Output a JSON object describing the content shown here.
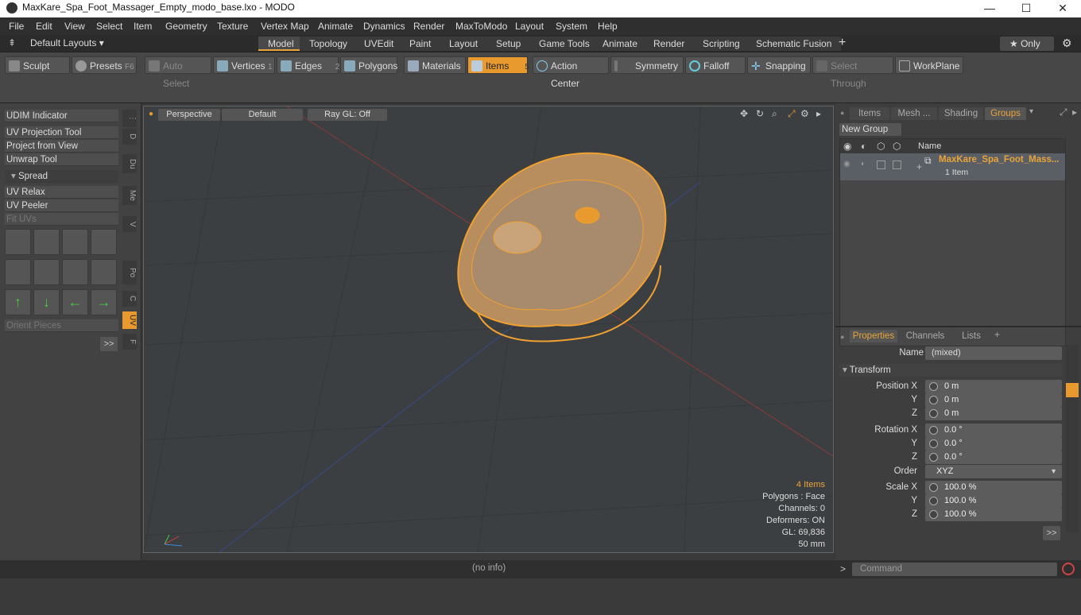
{
  "window": {
    "title": "MaxKare_Spa_Foot_Massager_Empty_modo_base.lxo - MODO",
    "min": "—",
    "max": "☐",
    "close": "✕"
  },
  "menu": [
    "File",
    "Edit",
    "View",
    "Select",
    "Item",
    "Geometry",
    "Texture",
    "Vertex Map",
    "Animate",
    "Dynamics",
    "Render",
    "MaxToModo",
    "Layout",
    "System",
    "Help"
  ],
  "layouts": {
    "default": "Default Layouts ▾",
    "tabs": [
      "Model",
      "Topology",
      "UVEdit",
      "Paint",
      "Layout",
      "Setup",
      "Game Tools",
      "Animate",
      "Render",
      "Scripting",
      "Schematic Fusion"
    ],
    "plus": "+",
    "only": "★  Only",
    "gear": "⚙"
  },
  "toolbar": {
    "sculpt": "Sculpt",
    "presets": "Presets",
    "presets_key": "F6",
    "auto_select": "Auto Select",
    "vertices": "Vertices",
    "vertices_n": "1",
    "edges": "Edges",
    "edges_n": "2",
    "polygons": "Polygons",
    "materials": "Materials",
    "items": "Items",
    "items_n": "5",
    "action_center": "Action Center",
    "symmetry": "Symmetry",
    "falloff": "Falloff",
    "snapping": "Snapping",
    "select_through": "Select Through",
    "workplane": "WorkPlane"
  },
  "left": {
    "buttons": [
      "UDIM Indicator",
      "UV Projection Tool",
      "Project from View",
      "Unwrap Tool"
    ],
    "spread": "Spread",
    "buttons2": [
      "UV Relax",
      "UV Peeler"
    ],
    "fit": "Fit UVs",
    "orient": "Orient Pieces",
    "more": ">>",
    "vtabs": [
      "D",
      "Du",
      "Me",
      "V",
      "Po",
      "C",
      "UV",
      "F"
    ]
  },
  "viewport": {
    "perspective": "Perspective",
    "default": "Default",
    "raygl": "Ray GL: Off",
    "items": "4 Items",
    "polygons": "Polygons : Face",
    "channels": "Channels: 0",
    "deformers": "Deformers: ON",
    "gl": "GL: 69,836",
    "mm": "50 mm"
  },
  "groups": {
    "tabs": [
      "Items",
      "Mesh ...",
      "Shading",
      "Groups"
    ],
    "new_group": "New Group",
    "name_col": "Name",
    "row_name": "MaxKare_Spa_Foot_Mass...",
    "row_sub": "1 Item"
  },
  "properties": {
    "tabs": [
      "Properties",
      "Channels",
      "Lists"
    ],
    "plus": "+",
    "name_label": "Name",
    "name_value": "(mixed)",
    "transform": "Transform",
    "rows": [
      {
        "label": "Position X",
        "value": "0 m"
      },
      {
        "label": "Y",
        "value": "0 m"
      },
      {
        "label": "Z",
        "value": "0 m"
      },
      {
        "label": "Rotation X",
        "value": "0.0 °"
      },
      {
        "label": "Y",
        "value": "0.0 °"
      },
      {
        "label": "Z",
        "value": "0.0 °"
      },
      {
        "label": "Order",
        "value": "XYZ"
      },
      {
        "label": "Scale X",
        "value": "100.0 %"
      },
      {
        "label": "Y",
        "value": "100.0 %"
      },
      {
        "label": "Z",
        "value": "100.0 %"
      }
    ],
    "more": ">>"
  },
  "status": {
    "info": "(no info)",
    "prompt": ">",
    "command": "Command"
  },
  "colors": {
    "accent": "#e89a2f",
    "wire": "#f0a030"
  }
}
